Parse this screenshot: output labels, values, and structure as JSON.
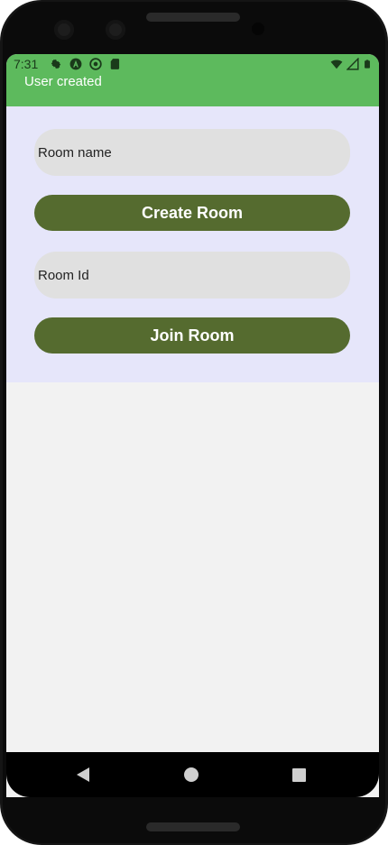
{
  "status_bar": {
    "time": "7:31",
    "background_color": "#5dba5d",
    "left_icons": [
      "settings-icon",
      "a-badge-icon",
      "sync-icon",
      "sd-card-icon"
    ],
    "right_icons": [
      "wifi-icon",
      "signal-icon",
      "battery-icon"
    ]
  },
  "toast": {
    "message": "User created"
  },
  "form": {
    "room_name_placeholder": "Room name",
    "create_button_label": "Create Room",
    "room_id_placeholder": "Room Id",
    "join_button_label": "Join Room",
    "panel_color": "#e6e6fa",
    "button_color": "#556b2f",
    "field_color": "#e0e0e0"
  },
  "nav_bar": {
    "buttons": [
      "back-icon",
      "home-icon",
      "recents-icon"
    ]
  }
}
